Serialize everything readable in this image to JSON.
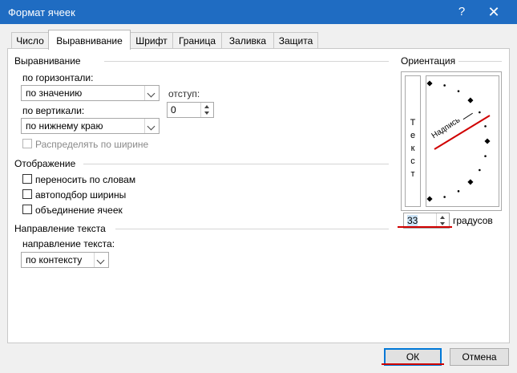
{
  "window": {
    "title": "Формат ячеек",
    "help_glyph": "?",
    "close_glyph": "✕",
    "titlebar_color": "#1f6cc2"
  },
  "tabs": [
    {
      "label": "Число"
    },
    {
      "label": "Выравнивание",
      "active": true
    },
    {
      "label": "Шрифт"
    },
    {
      "label": "Граница"
    },
    {
      "label": "Заливка"
    },
    {
      "label": "Защита"
    }
  ],
  "alignment": {
    "group_label": "Выравнивание",
    "horizontal_label": "по горизонтали:",
    "horizontal_value": "по значению",
    "indent_label": "отступ:",
    "indent_value": "0",
    "vertical_label": "по вертикали:",
    "vertical_value": "по нижнему краю",
    "distribute_label": "Распределять по ширине"
  },
  "display": {
    "group_label": "Отображение",
    "wrap_label": "переносить по словам",
    "shrink_label": "автоподбор ширины",
    "merge_label": "объединение ячеек"
  },
  "direction": {
    "group_label": "Направление текста",
    "direction_label": "направление текста:",
    "direction_value": "по контексту"
  },
  "orientation": {
    "group_label": "Ориентация",
    "vertical_text": [
      "Т",
      "е",
      "к",
      "с",
      "т"
    ],
    "dial_text": "Надпись",
    "degrees_value": "33",
    "degrees_label": "градусов",
    "angle": 33
  },
  "buttons": {
    "ok": "ОК",
    "cancel": "Отмена"
  },
  "annotation_color": "#d00000"
}
